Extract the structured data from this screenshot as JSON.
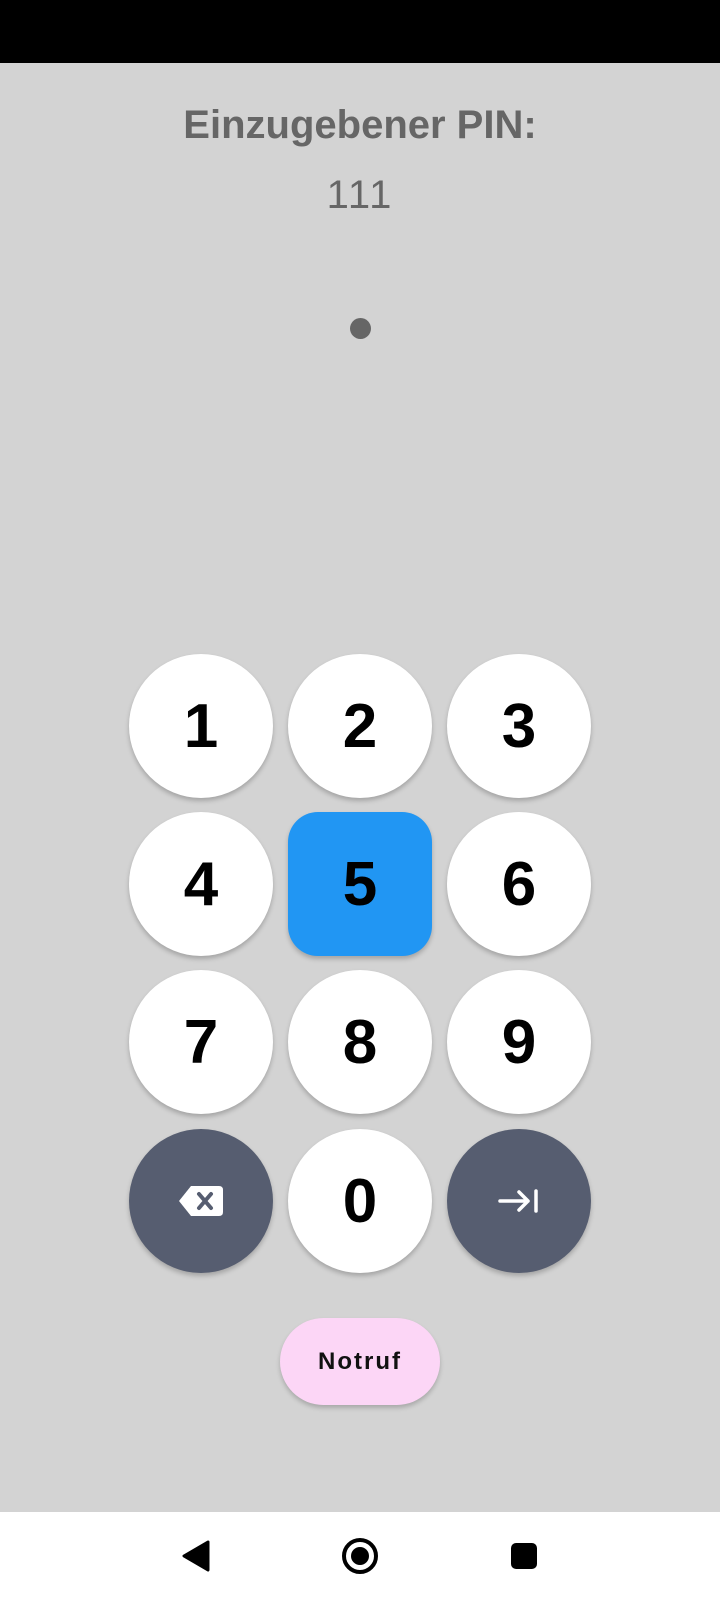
{
  "pin": {
    "title": "Einzugebener PIN:",
    "value": "111",
    "entered_digits": 1
  },
  "keypad": {
    "keys": [
      "1",
      "2",
      "3",
      "4",
      "5",
      "6",
      "7",
      "8",
      "9",
      "0"
    ],
    "active_key": "5",
    "backspace_icon": "backspace-icon",
    "submit_icon": "arrow-right-to-bar-icon"
  },
  "emergency_button": {
    "label": "Notruf"
  },
  "navigation": {
    "back_icon": "back-triangle-icon",
    "home_icon": "home-circle-icon",
    "recents_icon": "recents-square-icon"
  },
  "colors": {
    "background": "#d3d3d3",
    "key": "#ffffff",
    "active_key": "#2196f3",
    "action_key": "#565d70",
    "emergency": "#fcd6f6",
    "text_muted": "#666666"
  }
}
